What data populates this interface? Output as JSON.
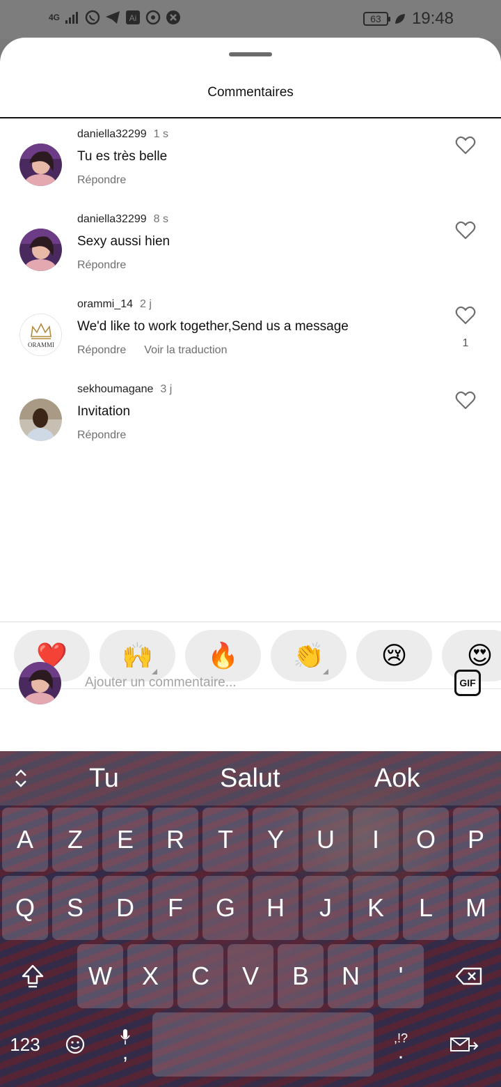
{
  "status_bar": {
    "network": "4G",
    "battery": "63",
    "time": "19:48"
  },
  "sheet": {
    "title": "Commentaires"
  },
  "comments": [
    {
      "user": "daniella32299",
      "time": "1 s",
      "text": "Tu es très belle",
      "reply": "Répondre",
      "likes": ""
    },
    {
      "user": "daniella32299",
      "time": "8 s",
      "text": "Sexy aussi hien",
      "reply": "Répondre",
      "likes": ""
    },
    {
      "user": "orammi_14",
      "time": "2 j",
      "text": "We'd like to work together,Send us a message",
      "reply": "Répondre",
      "translate": "Voir la traduction",
      "likes": "1",
      "avatar_text": "ORAMMI"
    },
    {
      "user": "sekhoumagane",
      "time": "3 j",
      "text": "Invitation",
      "reply": "Répondre",
      "likes": ""
    }
  ],
  "reactions": [
    "❤️",
    "🙌",
    "🔥",
    "👏",
    "😢",
    "😍"
  ],
  "composer": {
    "placeholder": "Ajouter un commentaire...",
    "gif_label": "GIF"
  },
  "keyboard": {
    "suggestions": [
      "Tu",
      "Salut",
      "Aok"
    ],
    "row1": [
      "A",
      "Z",
      "E",
      "R",
      "T",
      "Y",
      "U",
      "I",
      "O",
      "P"
    ],
    "row2": [
      "Q",
      "S",
      "D",
      "F",
      "G",
      "H",
      "J",
      "K",
      "L",
      "M"
    ],
    "row3": [
      "W",
      "X",
      "C",
      "V",
      "B",
      "N",
      "'"
    ],
    "numbers_label": "123",
    "comma": ",",
    "punct_label": ",!?",
    "period": "."
  }
}
